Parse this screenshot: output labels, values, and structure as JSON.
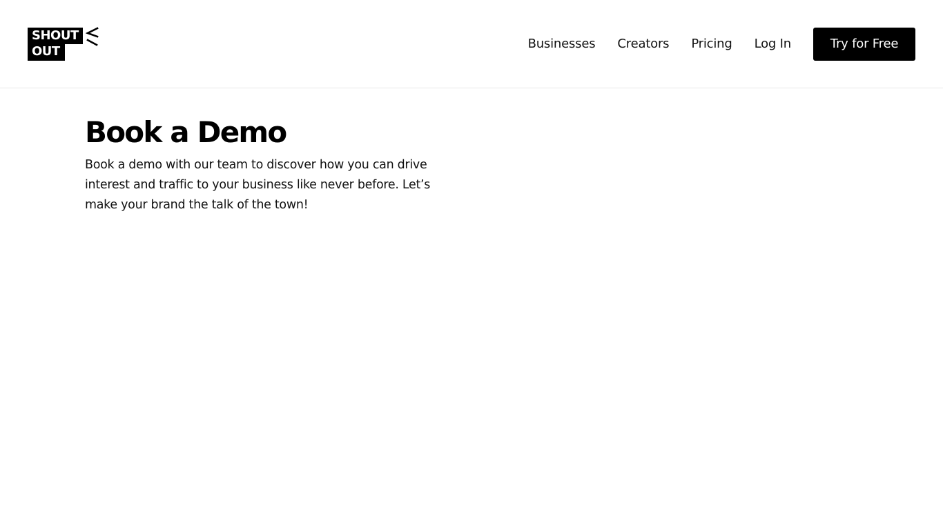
{
  "brand": {
    "logo_line1": "SHOUT",
    "logo_line2": "OUT",
    "logo_mark_icon": "megaphone-lines-icon"
  },
  "nav": {
    "items": [
      {
        "label": "Businesses"
      },
      {
        "label": "Creators"
      },
      {
        "label": "Pricing"
      },
      {
        "label": "Log In"
      }
    ],
    "cta_label": "Try for Free"
  },
  "main": {
    "title": "Book a Demo",
    "description": "Book a demo with our team to discover how you can drive interest and traffic to your business like never before. Let’s make your brand the talk of the town!"
  },
  "colors": {
    "background": "#ffffff",
    "text": "#000000",
    "cta_background": "#000000",
    "cta_text": "#ffffff",
    "divider": "#e6e6e6"
  }
}
